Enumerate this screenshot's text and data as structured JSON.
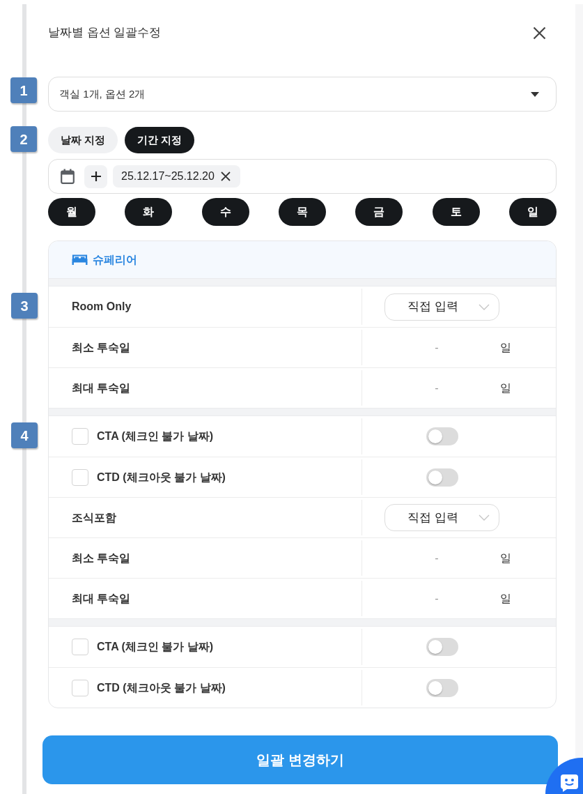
{
  "dialog": {
    "title": "날짜별 옵션 일괄수정"
  },
  "room_select": {
    "marker": "1",
    "value": "객실 1개, 옵션 2개"
  },
  "date_modes": {
    "marker": "2",
    "tabs": [
      {
        "label": "날짜 지정",
        "selected": false
      },
      {
        "label": "기간 지정",
        "selected": true
      }
    ]
  },
  "date_field": {
    "chips": [
      {
        "label": "25.12.17~25.12.20"
      }
    ]
  },
  "weekdays": [
    {
      "label": "월",
      "selected": true
    },
    {
      "label": "화",
      "selected": true
    },
    {
      "label": "수",
      "selected": true
    },
    {
      "label": "목",
      "selected": true
    },
    {
      "label": "금",
      "selected": true
    },
    {
      "label": "토",
      "selected": true
    },
    {
      "label": "일",
      "selected": true
    }
  ],
  "room": {
    "name": "슈페리어",
    "groups": [
      {
        "rows": [
          {
            "kind": "plan",
            "marker": "3",
            "label": "Room Only",
            "select": "직접 입력"
          },
          {
            "kind": "stay",
            "label": "최소 투숙일",
            "placeholder": "-",
            "unit": "일"
          },
          {
            "kind": "stay",
            "label": "최대 투숙일",
            "placeholder": "-",
            "unit": "일"
          }
        ]
      },
      {
        "rows": [
          {
            "kind": "restriction",
            "marker": "4",
            "label": "CTA (체크인 불가 날짜)",
            "checked": false,
            "on": false
          },
          {
            "kind": "restriction",
            "label": "CTD (체크아웃 불가 날짜)",
            "checked": false,
            "on": false
          },
          {
            "kind": "plan",
            "label": "조식포함",
            "select": "직접 입력"
          },
          {
            "kind": "stay",
            "label": "최소 투숙일",
            "placeholder": "-",
            "unit": "일"
          },
          {
            "kind": "stay",
            "label": "최대 투숙일",
            "placeholder": "-",
            "unit": "일"
          }
        ]
      },
      {
        "rows": [
          {
            "kind": "restriction",
            "label": "CTA (체크인 불가 날짜)",
            "checked": false,
            "on": false
          },
          {
            "kind": "restriction",
            "label": "CTD (체크아웃 불가 날짜)",
            "checked": false,
            "on": false
          }
        ]
      }
    ]
  },
  "submit_button": {
    "label": "일괄 변경하기"
  }
}
